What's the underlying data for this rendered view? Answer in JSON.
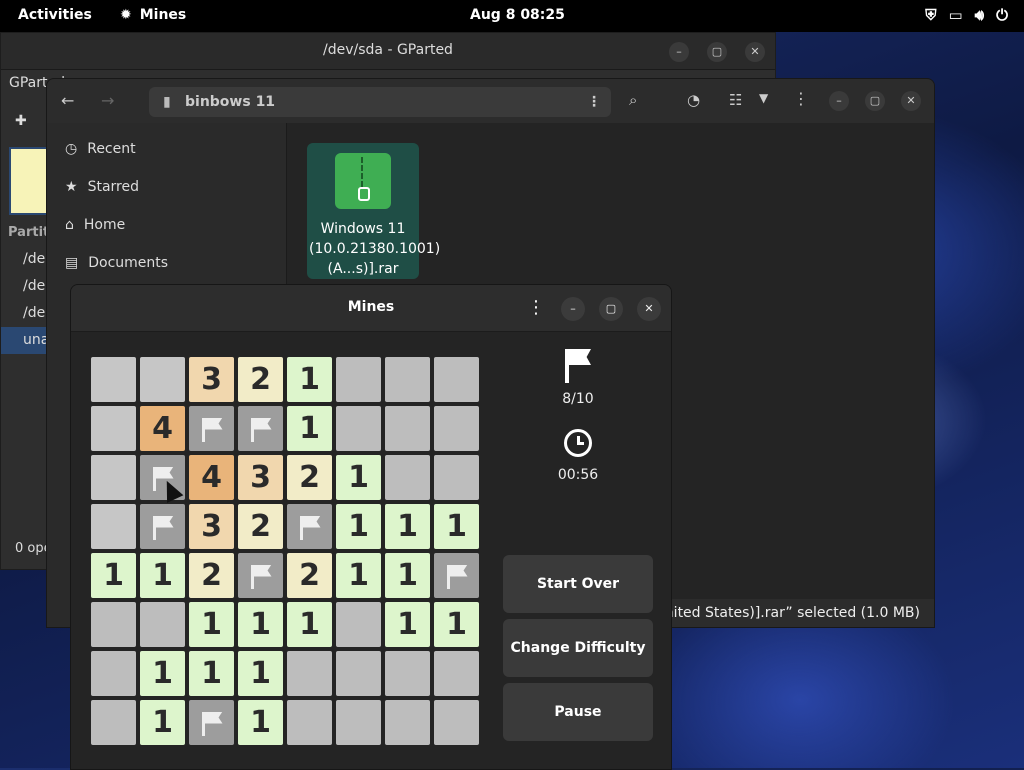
{
  "topbar": {
    "activities": "Activities",
    "app_name": "Mines",
    "clock": "Aug 8  08:25",
    "tray_icons": [
      "shield-icon",
      "display-icon",
      "volume-icon",
      "power-icon"
    ]
  },
  "gparted": {
    "title": "/dev/sda - GParted",
    "app_label": "GParted",
    "partition_header": "Partit",
    "rows": [
      "/de",
      "/de",
      "/de",
      "una"
    ],
    "status": "0 ope"
  },
  "files": {
    "path": "binbows 11",
    "sidebar": [
      "Recent",
      "Starred",
      "Home",
      "Documents"
    ],
    "file_name": "Windows 11 (10.0.21380.1001) (A...s)].rar",
    "status": "United States)].rar” selected  (1.0 MB)"
  },
  "mines": {
    "title": "Mines",
    "flags": "8/10",
    "time": "00:56",
    "start_over": "Start Over",
    "change_difficulty": "Change Difficulty",
    "pause": "Pause",
    "board": [
      [
        "h",
        "h",
        "3",
        "2",
        "1",
        "e",
        "e",
        "e"
      ],
      [
        "h",
        "4",
        "F",
        "F",
        "1",
        "e",
        "e",
        "e"
      ],
      [
        "h",
        "F",
        "4",
        "3",
        "2",
        "1",
        "e",
        "e"
      ],
      [
        "h",
        "F",
        "3",
        "2",
        "F",
        "1",
        "1",
        "1"
      ],
      [
        "1",
        "1",
        "2",
        "F",
        "2",
        "1",
        "1",
        "F"
      ],
      [
        "e",
        "e",
        "1",
        "1",
        "1",
        "e",
        "1",
        "1"
      ],
      [
        "e",
        "1",
        "1",
        "1",
        "e",
        "e",
        "e",
        "e"
      ],
      [
        "e",
        "1",
        "F",
        "1",
        "e",
        "e",
        "e",
        "e"
      ]
    ]
  },
  "colors": {
    "accent": "#2a4872",
    "file_icon": "#3fae53",
    "num1_bg": "#ddf5cc",
    "num2_bg": "#f2ecc8",
    "num3_bg": "#f1d7ae",
    "num4_bg": "#e9b47a"
  }
}
